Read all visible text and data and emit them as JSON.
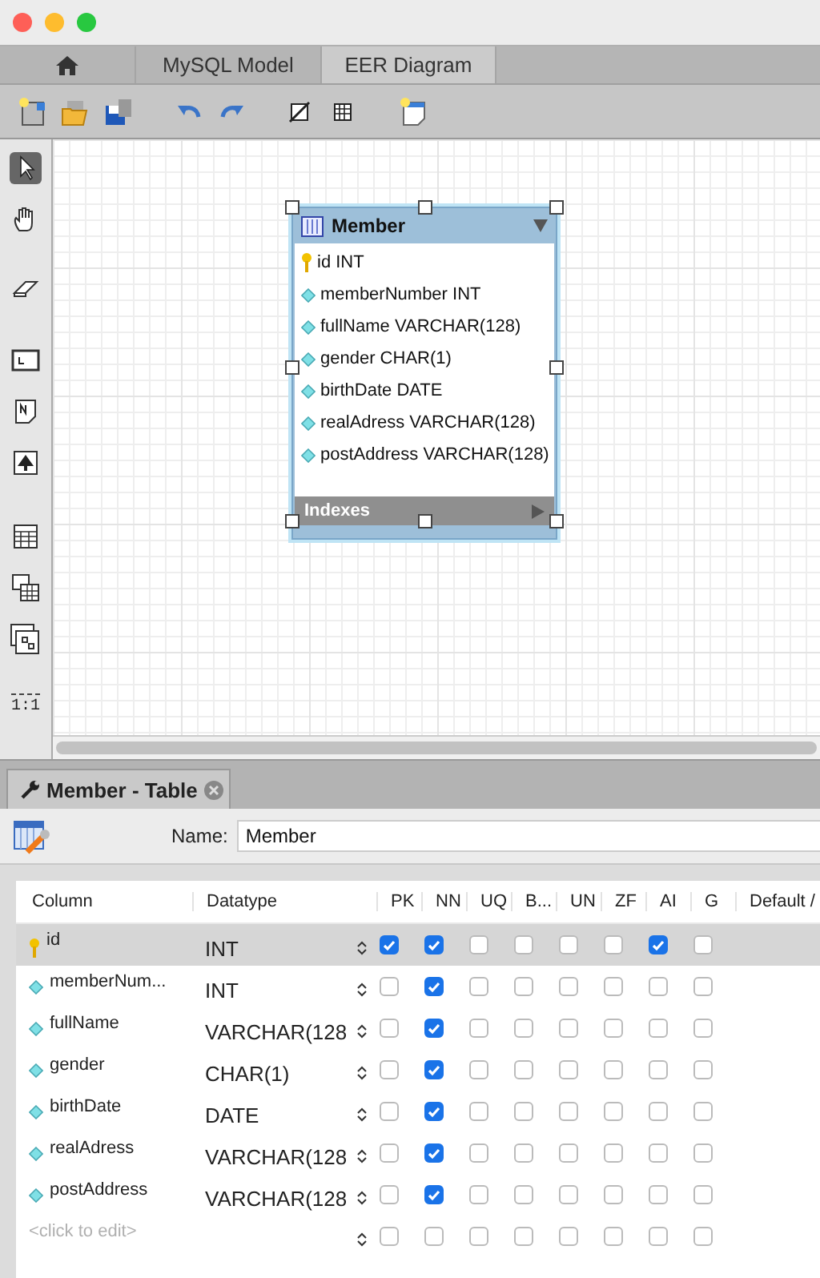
{
  "tabs": [
    {
      "kind": "home",
      "selected": false
    },
    {
      "kind": "text",
      "label": "MySQL Model",
      "selected": false
    },
    {
      "kind": "text",
      "label": "EER Diagram",
      "selected": true
    }
  ],
  "palette": {
    "zoom": "1:1"
  },
  "entity": {
    "title": "Member",
    "indexes": "Indexes",
    "attributes": [
      {
        "kind": "key",
        "text": "id INT"
      },
      {
        "kind": "attribute",
        "text": "memberNumber INT"
      },
      {
        "kind": "attribute",
        "text": "fullName VARCHAR(128)"
      },
      {
        "kind": "attribute",
        "text": "gender CHAR(1)"
      },
      {
        "kind": "attribute",
        "text": "birthDate DATE"
      },
      {
        "kind": "attribute",
        "text": "realAdress VARCHAR(128)"
      },
      {
        "kind": "attribute",
        "text": "postAddress VARCHAR(128)"
      }
    ]
  },
  "editor": {
    "tab": "Member - Table",
    "name_label": "Name:",
    "name_value": "Member",
    "columns": [
      "Column",
      "Datatype",
      "PK",
      "NN",
      "UQ",
      "B...",
      "UN",
      "ZF",
      "AI",
      "G",
      "Default /"
    ],
    "rows": [
      {
        "kind": "key",
        "name": "id",
        "datatype": "INT",
        "selected": true,
        "checks": [
          true,
          true,
          false,
          false,
          false,
          false,
          true,
          false
        ]
      },
      {
        "kind": "attribute",
        "name": "memberNum...",
        "datatype": "INT",
        "selected": false,
        "checks": [
          false,
          true,
          false,
          false,
          false,
          false,
          false,
          false
        ]
      },
      {
        "kind": "attribute",
        "name": "fullName",
        "datatype": "VARCHAR(128",
        "selected": false,
        "checks": [
          false,
          true,
          false,
          false,
          false,
          false,
          false,
          false
        ]
      },
      {
        "kind": "attribute",
        "name": "gender",
        "datatype": "CHAR(1)",
        "selected": false,
        "checks": [
          false,
          true,
          false,
          false,
          false,
          false,
          false,
          false
        ]
      },
      {
        "kind": "attribute",
        "name": "birthDate",
        "datatype": "DATE",
        "selected": false,
        "checks": [
          false,
          true,
          false,
          false,
          false,
          false,
          false,
          false
        ]
      },
      {
        "kind": "attribute",
        "name": "realAdress",
        "datatype": "VARCHAR(128",
        "selected": false,
        "checks": [
          false,
          true,
          false,
          false,
          false,
          false,
          false,
          false
        ]
      },
      {
        "kind": "attribute",
        "name": "postAddress",
        "datatype": "VARCHAR(128",
        "selected": false,
        "checks": [
          false,
          true,
          false,
          false,
          false,
          false,
          false,
          false
        ]
      },
      {
        "kind": "new",
        "placeholder": "<click to edit>",
        "selected": false,
        "checks": [
          false,
          false,
          false,
          false,
          false,
          false,
          false,
          false
        ]
      }
    ]
  }
}
